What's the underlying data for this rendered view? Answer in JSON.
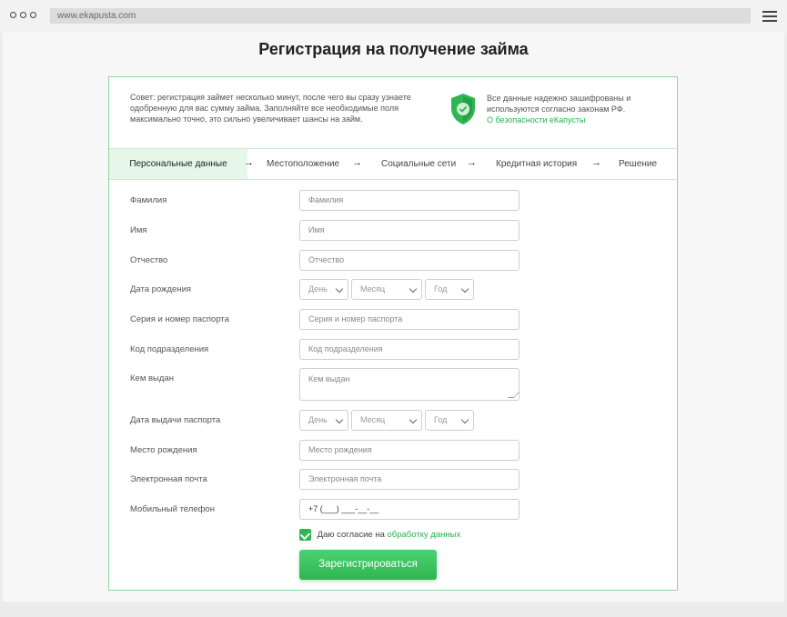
{
  "browser": {
    "url": "www.ekapusta.com"
  },
  "page": {
    "title": "Регистрация на получение займа"
  },
  "tip": "Совет: регистрация займет несколько минут, после чего вы сразу узнаете одобренную для вас сумму займа. Заполняйте все необходимые поля максимально точно, это сильно увеличивает шансы на займ.",
  "security": {
    "text": "Все данные надежно зашифрованы и используются согласно законам РФ.",
    "link": "О безопасности еКапусты"
  },
  "steps": [
    {
      "label": "Персональные данные",
      "active": true
    },
    {
      "label": "Местоположение",
      "active": false
    },
    {
      "label": "Социальные сети",
      "active": false
    },
    {
      "label": "Кредитная история",
      "active": false
    },
    {
      "label": "Решение",
      "active": false
    }
  ],
  "step_arrow": "→",
  "fields": {
    "last_name": {
      "label": "Фамилия",
      "placeholder": "Фамилия"
    },
    "first_name": {
      "label": "Имя",
      "placeholder": "Имя"
    },
    "patronymic": {
      "label": "Отчество",
      "placeholder": "Отчество"
    },
    "birth_date": {
      "label": "Дата рождения",
      "day": "День",
      "month": "Месяц",
      "year": "Год"
    },
    "passport": {
      "label": "Серия и номер паспорта",
      "placeholder": "Серия и номер паспорта"
    },
    "division_code": {
      "label": "Код подразделения",
      "placeholder": "Код подразделения"
    },
    "issued_by": {
      "label": "Кем выдан",
      "placeholder": "Кем выдан"
    },
    "issue_date": {
      "label": "Дата выдачи паспорта",
      "day": "День",
      "month": "Месяц",
      "year": "Год"
    },
    "birth_place": {
      "label": "Место рождения",
      "placeholder": "Место рождения"
    },
    "email": {
      "label": "Электронная почта",
      "placeholder": "Электронная почта"
    },
    "phone": {
      "label": "Мобильный телефон",
      "value": "+7 (___) ___-__-__"
    }
  },
  "consent": {
    "checked": true,
    "text": "Даю согласие на",
    "link": "обработку данных"
  },
  "submit_label": "Зарегистрироваться",
  "colors": {
    "accent": "#2fb552",
    "card_border": "#8fd6a1",
    "active_step_bg": "#e6f7ea"
  }
}
